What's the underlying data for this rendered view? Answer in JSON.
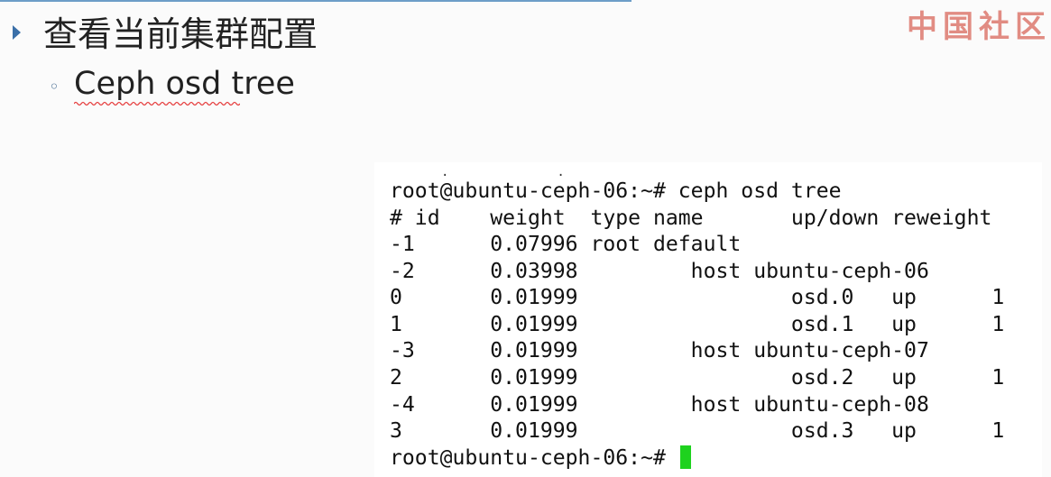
{
  "slide": {
    "heading": "查看当前集群配置",
    "subheading": "Ceph osd tree",
    "watermark": "中国社区"
  },
  "terminal": {
    "prompt": "root@ubuntu-ceph-06:~#",
    "command_line": "root@ubuntu-ceph-06:~# ceph osd tree",
    "lines": [
      "# id    weight  type name       up/down reweight",
      "-1      0.07996 root default",
      "-2      0.03998         host ubuntu-ceph-06",
      "0       0.01999                 osd.0   up      1",
      "1       0.01999                 osd.1   up      1",
      "-3      0.01999         host ubuntu-ceph-07",
      "2       0.01999                 osd.2   up      1",
      "-4      0.01999         host ubuntu-ceph-08",
      "3       0.01999                 osd.3   up      1"
    ],
    "final_prompt": "root@ubuntu-ceph-06:~#",
    "cursor_color": "#1ed21e"
  },
  "colors": {
    "accent": "#3a6fa8",
    "watermark": "#d9675c"
  }
}
